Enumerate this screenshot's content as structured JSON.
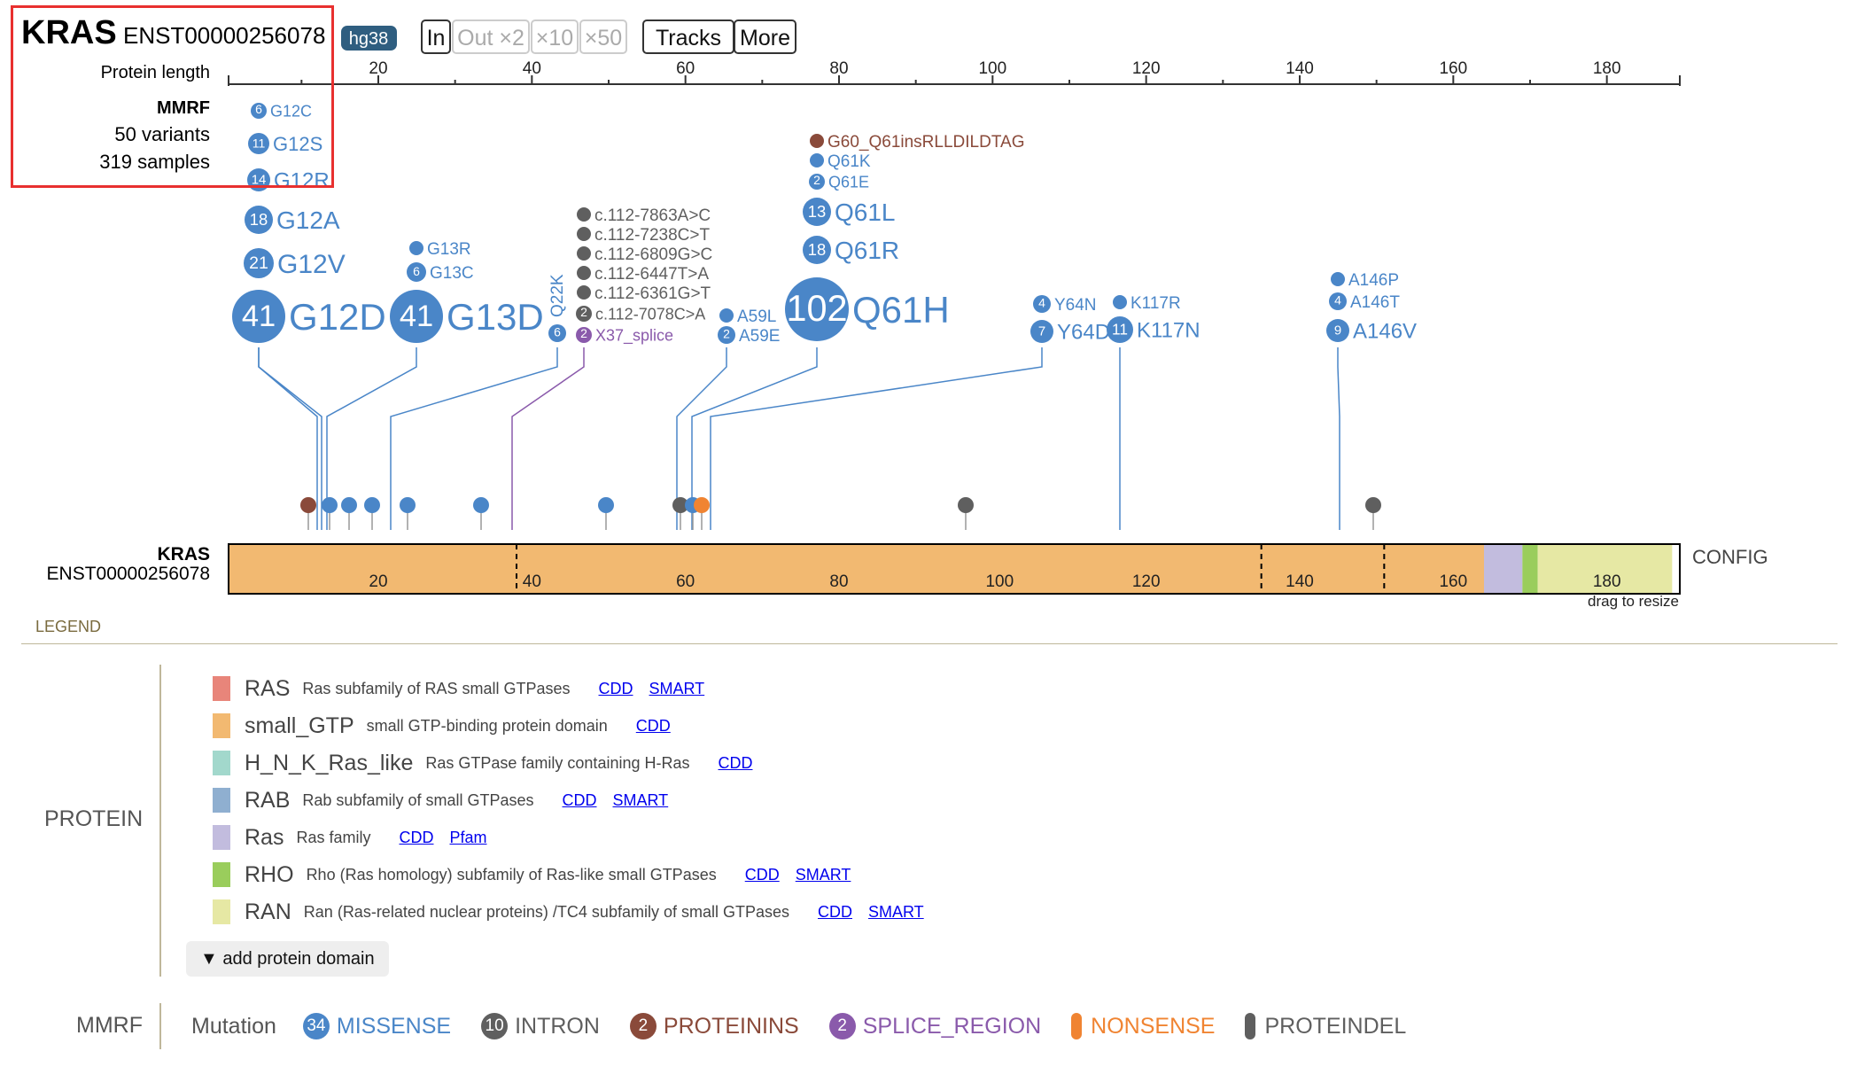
{
  "header": {
    "gene": "KRAS",
    "isoform": "ENST00000256078",
    "genome_badge": "hg38",
    "buttons": {
      "zoom_in": "In",
      "zoom_out_2": "Out ×2",
      "zoom_out_10": "×10",
      "zoom_out_50": "×50",
      "tracks": "Tracks",
      "more": "More"
    }
  },
  "left_info": {
    "protein_length_label": "Protein length",
    "dataset": "MMRF",
    "variants": "50 variants",
    "samples": "319 samples"
  },
  "ruler_ticks": [
    "20",
    "40",
    "60",
    "80",
    "100",
    "120",
    "140",
    "160",
    "180"
  ],
  "track_label": {
    "gene": "KRAS",
    "isoform": "ENST00000256078"
  },
  "config_label": "CONFIG",
  "drag_hint": "drag to resize",
  "colors": {
    "missense": "#4a86c8",
    "intron": "#5f5f5f",
    "proteinins": "#8a4a3a",
    "splice_region": "#8a5aab",
    "nonsense": "#f08432",
    "proteindel": "#5f5f5f",
    "small_GTP": "#f2b971",
    "Ras": "#c2bcde",
    "RHO": "#9acd5c",
    "RAN": "#e6e8a4"
  },
  "variants": [
    {
      "label": "G12C",
      "count": "6",
      "cls": "missense"
    },
    {
      "label": "G12S",
      "count": "11",
      "cls": "missense"
    },
    {
      "label": "G12R",
      "count": "14",
      "cls": "missense"
    },
    {
      "label": "G12A",
      "count": "18",
      "cls": "missense"
    },
    {
      "label": "G12V",
      "count": "21",
      "cls": "missense"
    },
    {
      "label": "G12D",
      "count": "41",
      "cls": "missense"
    },
    {
      "label": "G13R",
      "count": "",
      "cls": "missense"
    },
    {
      "label": "G13C",
      "count": "6",
      "cls": "missense"
    },
    {
      "label": "G13D",
      "count": "41",
      "cls": "missense"
    },
    {
      "label": "Q22K",
      "count": "6",
      "cls": "missense"
    },
    {
      "label": "c.112-7863A>C",
      "count": "",
      "cls": "intron"
    },
    {
      "label": "c.112-7238C>T",
      "count": "",
      "cls": "intron"
    },
    {
      "label": "c.112-6809G>C",
      "count": "",
      "cls": "intron"
    },
    {
      "label": "c.112-6447T>A",
      "count": "",
      "cls": "intron"
    },
    {
      "label": "c.112-6361G>T",
      "count": "",
      "cls": "intron"
    },
    {
      "label": "c.112-7078C>A",
      "count": "2",
      "cls": "intron"
    },
    {
      "label": "X37_splice",
      "count": "2",
      "cls": "splice_region"
    },
    {
      "label": "A59L",
      "count": "",
      "cls": "missense"
    },
    {
      "label": "A59E",
      "count": "2",
      "cls": "missense"
    },
    {
      "label": "G60_Q61insRLLDILDTAG",
      "count": "",
      "cls": "proteinins"
    },
    {
      "label": "Q61K",
      "count": "",
      "cls": "missense"
    },
    {
      "label": "Q61E",
      "count": "2",
      "cls": "missense"
    },
    {
      "label": "Q61L",
      "count": "13",
      "cls": "missense"
    },
    {
      "label": "Q61R",
      "count": "18",
      "cls": "missense"
    },
    {
      "label": "Q61H",
      "count": "102",
      "cls": "missense"
    },
    {
      "label": "Y64N",
      "count": "4",
      "cls": "missense"
    },
    {
      "label": "Y64D",
      "count": "7",
      "cls": "missense"
    },
    {
      "label": "K117R",
      "count": "",
      "cls": "missense"
    },
    {
      "label": "K117N",
      "count": "11",
      "cls": "missense"
    },
    {
      "label": "A146P",
      "count": "",
      "cls": "missense"
    },
    {
      "label": "A146T",
      "count": "4",
      "cls": "missense"
    },
    {
      "label": "A146V",
      "count": "9",
      "cls": "missense"
    }
  ],
  "domain_track_ticks": [
    "20",
    "40",
    "60",
    "80",
    "100",
    "120",
    "140",
    "160",
    "180"
  ],
  "legend": {
    "title": "LEGEND",
    "protein_label": "PROTEIN",
    "domains": [
      {
        "name": "RAS",
        "desc": "Ras subfamily of RAS small GTPases",
        "color": "#e8857a",
        "links": [
          "CDD",
          "SMART"
        ]
      },
      {
        "name": "small_GTP",
        "desc": "small GTP-binding protein domain",
        "color": "#f2b971",
        "links": [
          "CDD"
        ]
      },
      {
        "name": "H_N_K_Ras_like",
        "desc": "Ras GTPase family containing H-Ras",
        "color": "#a2d8cc",
        "links": [
          "CDD"
        ]
      },
      {
        "name": "RAB",
        "desc": "Rab subfamily of small GTPases",
        "color": "#8fafd0",
        "links": [
          "CDD",
          "SMART"
        ]
      },
      {
        "name": "Ras",
        "desc": "Ras family",
        "color": "#c2bcde",
        "links": [
          "CDD",
          "Pfam"
        ]
      },
      {
        "name": "RHO",
        "desc": "Rho (Ras homology) subfamily of Ras-like small GTPases",
        "color": "#9acd5c",
        "links": [
          "CDD",
          "SMART"
        ]
      },
      {
        "name": "RAN",
        "desc": "Ran (Ras-related nuclear proteins) /TC4 subfamily of small GTPases",
        "color": "#e6e8a4",
        "links": [
          "CDD",
          "SMART"
        ]
      }
    ],
    "add_domain": "▼ add protein domain",
    "mmrf_label": "MMRF",
    "mutation_label": "Mutation",
    "mutation_classes": [
      {
        "name": "MISSENSE",
        "count": "34",
        "color": "#4a86c8",
        "shape": "dot"
      },
      {
        "name": "INTRON",
        "count": "10",
        "color": "#5f5f5f",
        "shape": "dot"
      },
      {
        "name": "PROTEININS",
        "count": "2",
        "color": "#8a4a3a",
        "shape": "dot"
      },
      {
        "name": "SPLICE_REGION",
        "count": "2",
        "color": "#8a5aab",
        "shape": "dot"
      },
      {
        "name": "NONSENSE",
        "count": "",
        "color": "#f08432",
        "shape": "bar"
      },
      {
        "name": "PROTEINDEL",
        "count": "",
        "color": "#5f5f5f",
        "shape": "bar"
      }
    ]
  }
}
